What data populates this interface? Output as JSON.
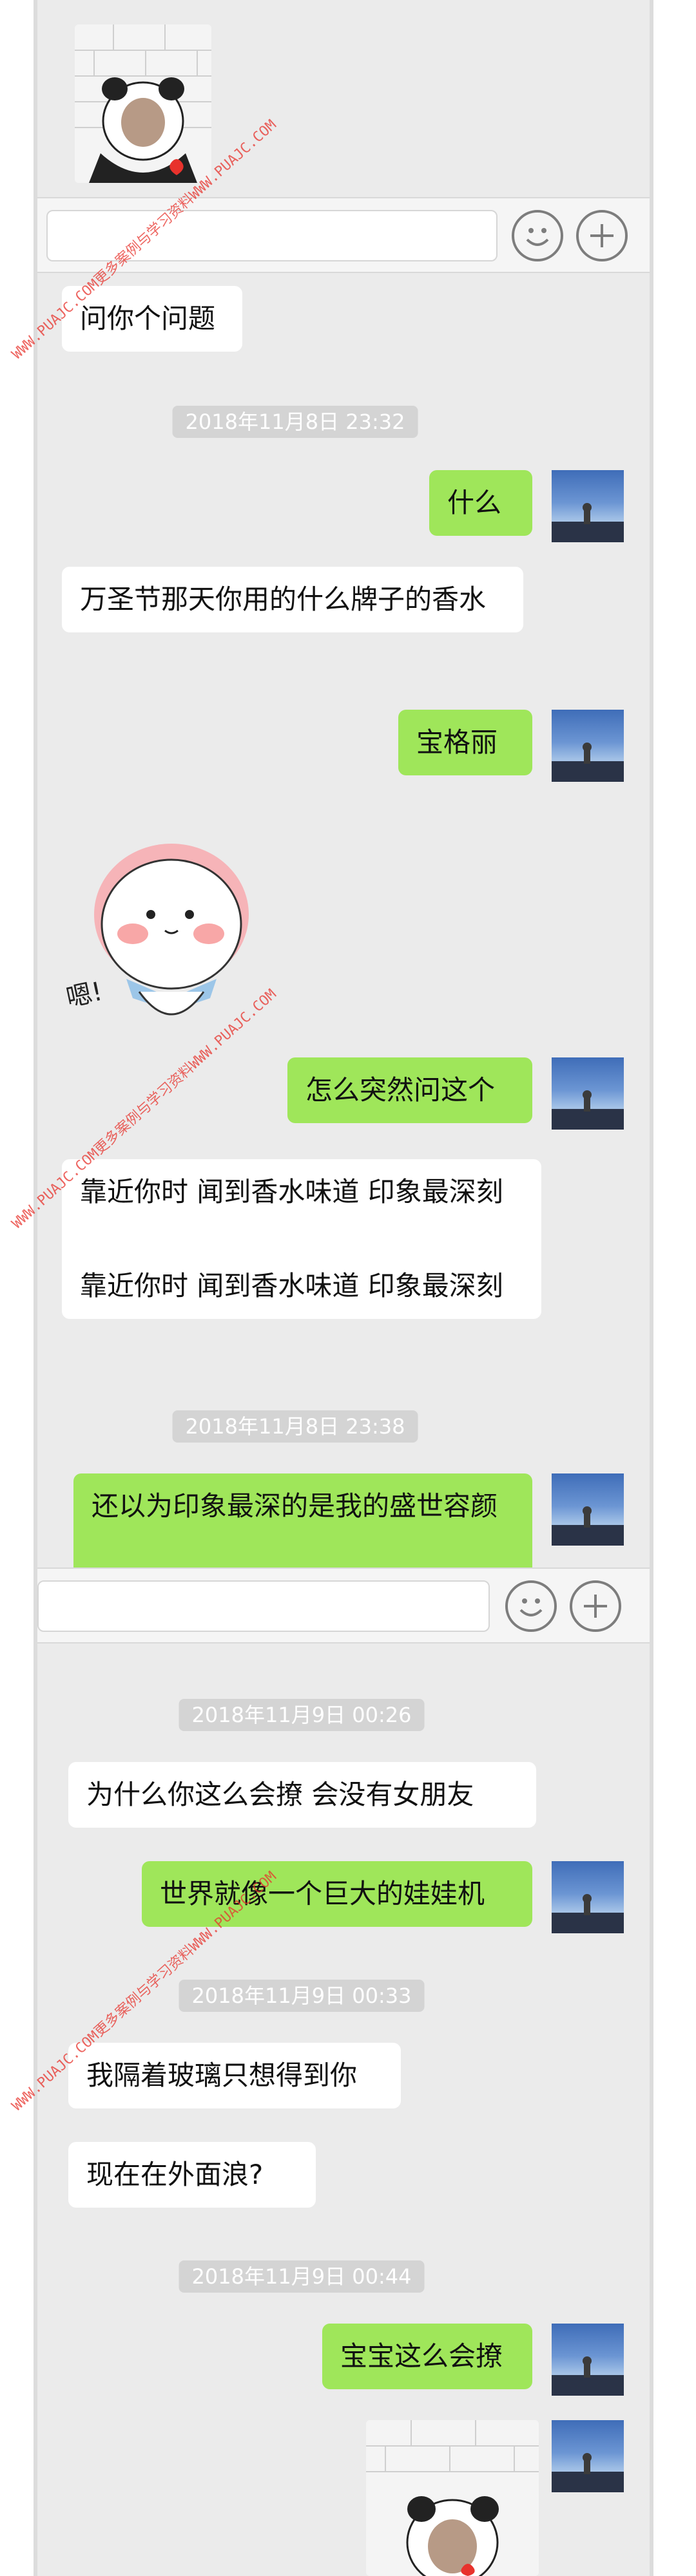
{
  "messages": {
    "m1": "问你个问题",
    "t1": "2018年11月8日 23:32",
    "m2": "什么",
    "m3": "万圣节那天你用的什么牌子的香水",
    "m4": "宝格丽",
    "sticker_text": "嗯!",
    "m5": "怎么突然问这个",
    "m6": "靠近你时 闻到香水味道 印象最深刻",
    "m7": "靠近你时 闻到香水味道 印象最深刻",
    "t2": "2018年11月8日 23:38",
    "m8": "还以为印象最深的是我的盛世容颜",
    "t3": "2018年11月9日 00:26",
    "m9": "为什么你这么会撩 会没有女朋友",
    "m10": "世界就像一个巨大的娃娃机",
    "t4": "2018年11月9日 00:33",
    "m11": "我隔着玻璃只想得到你",
    "m12": "现在在外面浪?",
    "t5": "2018年11月9日 00:44",
    "m13": "宝宝这么会撩"
  },
  "watermark": "WWW.PUAJC.COM更多案例与学习资料WWW.PUAJC.COM",
  "icons": {
    "emoji": "smiley-icon",
    "plus": "plus-icon"
  },
  "colors": {
    "chat_bg": "#ebebeb",
    "sent_bubble": "#9fe65a",
    "received_bubble": "#ffffff",
    "timestamp_bg": "#d4d4d4",
    "watermark": "#e8322c"
  }
}
